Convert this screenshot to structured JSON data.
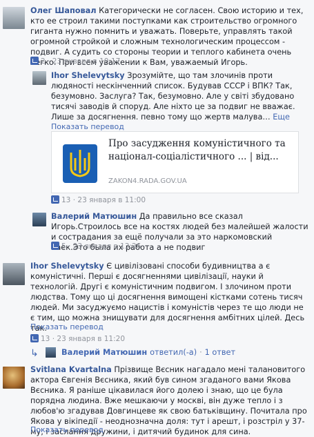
{
  "comments": [
    {
      "author": "Олег Шаповал",
      "text": "Категорически не согласен. Свою историю и тех, кто ее строил такими поступками как строительство огромного гиганта нужно помнить и уважать. Поверьте, управлять такой огромной стройкой и сложным технологическим процессом - подвиг. А судить со стороны теории и теплого кабинета очень легко. При всем уважении к Вам, уважаемый Игорь.",
      "likes": "2",
      "sep": "·",
      "date": "23 января в 10:17"
    },
    {
      "author": "Ihor Shelevytsky",
      "text": "Зрозумійте, що там злочинів проти людяності нескінченний список. Будував СССР і ВПК? Так, безумовно. Заслуга? Так, безумовно. Але у світі збудовано тисячі заводів й споруд. Але ніхто це за подвиг не вважає. Лише за досягнення. певно тому що жертв малува…",
      "more": "Еще",
      "translate": "Показать перевод",
      "card_title": "Про засудження комуністичного та націонал-соціалістичного ... | від...",
      "card_source": "ZAKON4.RADA.GOV.UA",
      "likes": "13",
      "sep": "·",
      "date": "23 января в 11:00"
    },
    {
      "author": "Валерий Матюшин",
      "text": "Да правильно все сказал Игорь.Строилось все на костях людей без малейшей жалости и сострадания за ещё получали за это наркомовский паек.Это была их работа а не подвиг",
      "likes": "5",
      "sep": "·",
      "date": "23 января в 13:26"
    },
    {
      "author": "Ihor Shelevytsky",
      "text": "Є цивілізовані способи будивництва а є комуністичні. Перші є досягненнями цивілізації, науки й технологій. Другі є комуністичним подвигом. І злочином проти людства. Тому що ці досягнення вимощені кістками сотень тисяч людей. Ми засуджуємо нацистів і комуністів через те що люди не є тим, що можна знищувати для досягнення амбітних цілей. Десь так.",
      "translate": "Показать перевод",
      "likes": "13",
      "sep": "·",
      "date": "23 января в 11:20",
      "reply_author": "Валерий Матюшин",
      "reply_text": "ответил(-а)",
      "reply_count": "1 ответ"
    },
    {
      "author": "Svitlana Kvartalna",
      "text": "Прізвище Вєсник нагадало мені талановитого актора Євгенія Вєсника, який був сином згаданого вами Якова Вєсника. Я раніше цікавилася його долею і знаю, що це була порядна людина. Вже мешкаючи у москві, він дуже тепло і з любов'ю згадував Довгинцеве як свою батьківщину. Почитала про Якова у вікіпедії - неоднозначна доля: тут і арешт, і розстріл у 37-му, і заслання дружини, і дитячий будинок для сина.",
      "translate": "Показать перевод"
    }
  ],
  "colors": {
    "link": "#4267b2",
    "name": "#365899",
    "meta": "#90949c"
  }
}
